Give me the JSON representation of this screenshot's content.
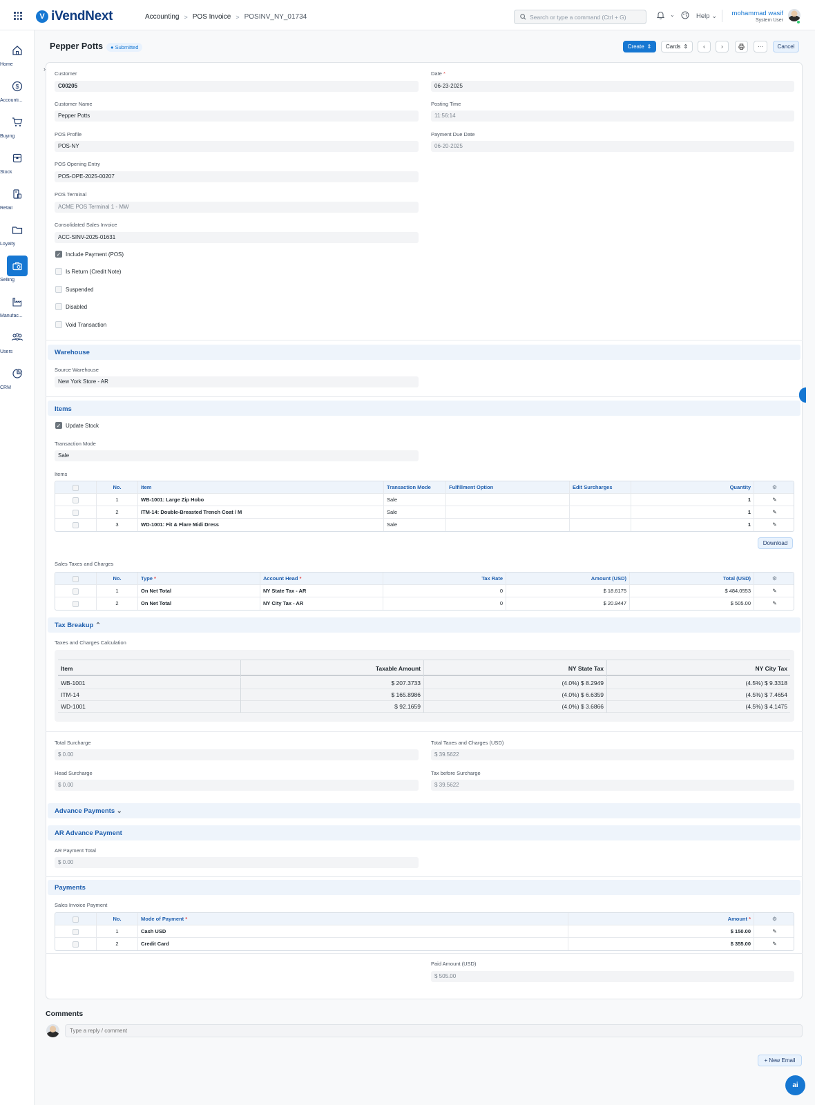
{
  "app": {
    "name": "iVendNext"
  },
  "breadcrumb": [
    "Accounting",
    "POS Invoice",
    "POSINV_NY_01734"
  ],
  "search": {
    "placeholder": "Search or type a command (Ctrl + G)"
  },
  "header": {
    "help": "Help",
    "user_name": "mohammad wasif",
    "user_role": "System User"
  },
  "sidebar": {
    "items": [
      {
        "label": "Home",
        "icon": "home-icon"
      },
      {
        "label": "Accounti...",
        "icon": "dollar-icon"
      },
      {
        "label": "Buying",
        "icon": "cart-icon"
      },
      {
        "label": "Stock",
        "icon": "box-icon"
      },
      {
        "label": "Retail",
        "icon": "retail-icon"
      },
      {
        "label": "Loyalty",
        "icon": "folder-icon"
      },
      {
        "label": "Selling",
        "icon": "selling-icon",
        "active": true
      },
      {
        "label": "Manufac...",
        "icon": "factory-icon"
      },
      {
        "label": "Users",
        "icon": "users-icon"
      },
      {
        "label": "CRM",
        "icon": "chart-icon"
      }
    ]
  },
  "doc": {
    "title": "Pepper Potts",
    "status": "Submitted"
  },
  "actions": {
    "create": "Create",
    "cards": "Cards",
    "cancel": "Cancel",
    "more": "···"
  },
  "form": {
    "customer": {
      "label": "Customer",
      "value": "C00205"
    },
    "customer_name": {
      "label": "Customer Name",
      "value": "Pepper Potts"
    },
    "pos_profile": {
      "label": "POS Profile",
      "value": "POS-NY"
    },
    "pos_opening_entry": {
      "label": "POS Opening Entry",
      "value": "POS-OPE-2025-00207"
    },
    "pos_terminal": {
      "label": "POS Terminal",
      "value": "ACME POS Terminal 1 - MW"
    },
    "consolidated": {
      "label": "Consolidated Sales Invoice",
      "value": "ACC-SINV-2025-01631"
    },
    "date": {
      "label": "Date",
      "value": "06-23-2025"
    },
    "posting_time": {
      "label": "Posting Time",
      "value": "11:56:14"
    },
    "due_date": {
      "label": "Payment Due Date",
      "value": "06-20-2025"
    },
    "checks": [
      {
        "label": "Include Payment (POS)",
        "checked": true
      },
      {
        "label": "Is Return (Credit Note)",
        "checked": false
      },
      {
        "label": "Suspended",
        "checked": false
      },
      {
        "label": "Disabled",
        "checked": false
      },
      {
        "label": "Void Transaction",
        "checked": false
      }
    ]
  },
  "warehouse": {
    "title": "Warehouse",
    "source_label": "Source Warehouse",
    "source_value": "New York Store - AR"
  },
  "items_section": {
    "title": "Items",
    "update_stock": "Update Stock",
    "transaction_mode_label": "Transaction Mode",
    "transaction_mode_value": "Sale",
    "table_label": "Items",
    "columns": [
      "No.",
      "Item",
      "Transaction Mode",
      "Fulfillment Option",
      "Edit Surcharges",
      "Quantity"
    ],
    "rows": [
      {
        "no": "1",
        "item": "WB-1001: Large Zip Hobo",
        "mode": "Sale",
        "qty": "1"
      },
      {
        "no": "2",
        "item": "ITM-14: Double-Breasted Trench Coat / M",
        "mode": "Sale",
        "qty": "1"
      },
      {
        "no": "3",
        "item": "WD-1001: Fit & Flare Midi Dress",
        "mode": "Sale",
        "qty": "1"
      }
    ],
    "download": "Download"
  },
  "taxes": {
    "label": "Sales Taxes and Charges",
    "columns": [
      "No.",
      "Type",
      "Account Head",
      "Tax Rate",
      "Amount (USD)",
      "Total (USD)"
    ],
    "rows": [
      {
        "no": "1",
        "type": "On Net Total",
        "head": "NY State Tax - AR",
        "rate": "0",
        "amount": "$ 18.6175",
        "total": "$ 484.0553"
      },
      {
        "no": "2",
        "type": "On Net Total",
        "head": "NY City Tax - AR",
        "rate": "0",
        "amount": "$ 20.9447",
        "total": "$ 505.00"
      }
    ]
  },
  "breakup": {
    "title": "Tax Breakup",
    "label": "Taxes and Charges Calculation",
    "columns": [
      "Item",
      "Taxable Amount",
      "NY State Tax",
      "NY City Tax"
    ],
    "rows": [
      [
        "WB-1001",
        "$ 207.3733",
        "(4.0%) $ 8.2949",
        "(4.5%) $ 9.3318"
      ],
      [
        "ITM-14",
        "$ 165.8986",
        "(4.0%) $ 6.6359",
        "(4.5%) $ 7.4654"
      ],
      [
        "WD-1001",
        "$ 92.1659",
        "(4.0%) $ 3.6866",
        "(4.5%) $ 4.1475"
      ]
    ]
  },
  "totals": {
    "total_surcharge": {
      "label": "Total Surcharge",
      "value": "$ 0.00"
    },
    "head_surcharge": {
      "label": "Head Surcharge",
      "value": "$ 0.00"
    },
    "total_taxes": {
      "label": "Total Taxes and Charges (USD)",
      "value": "$ 39.5622"
    },
    "tax_before": {
      "label": "Tax before Surcharge",
      "value": "$ 39.5622"
    }
  },
  "advance": {
    "title": "Advance Payments"
  },
  "ar_advance": {
    "title": "AR Advance Payment",
    "label": "AR Payment Total",
    "value": "$ 0.00"
  },
  "payments": {
    "title": "Payments",
    "label": "Sales Invoice Payment",
    "columns": [
      "No.",
      "Mode of Payment",
      "Amount"
    ],
    "rows": [
      {
        "no": "1",
        "mode": "Cash USD",
        "amount": "$ 150.00"
      },
      {
        "no": "2",
        "mode": "Credit Card",
        "amount": "$ 355.00"
      }
    ],
    "paid_label": "Paid Amount (USD)",
    "paid_value": "$ 505.00"
  },
  "comments": {
    "title": "Comments",
    "placeholder": "Type a reply / comment"
  },
  "footer": {
    "new_email": "+ New Email",
    "ai": "ai"
  }
}
